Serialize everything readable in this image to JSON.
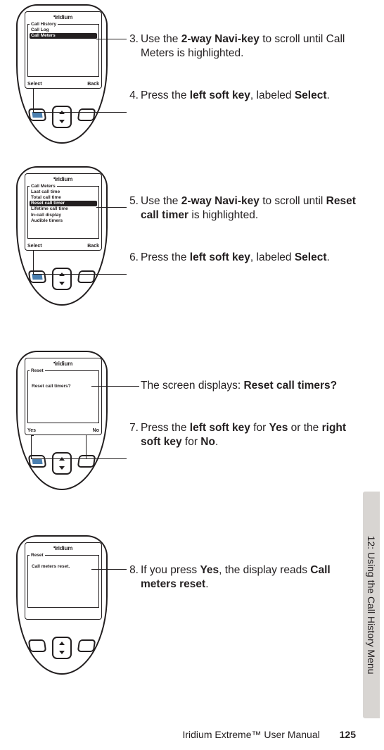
{
  "brand": "iridium",
  "screens": {
    "s1": {
      "title": "Call History",
      "items": [
        "Call Log",
        "Call Meters"
      ],
      "selected": 1,
      "left": "Select",
      "right": "Back"
    },
    "s2": {
      "title": "Call Meters",
      "items": [
        "Last call time",
        "Total call time",
        "Reset call timer",
        "Lifetime call time",
        "In-call display",
        "Audible timers"
      ],
      "selected": 2,
      "left": "Select",
      "right": "Back"
    },
    "s3": {
      "title": "Reset",
      "message": "Reset call timers?",
      "left": "Yes",
      "right": "No"
    },
    "s4": {
      "title": "Reset",
      "message": "Call meters reset.",
      "left": "",
      "right": ""
    }
  },
  "steps": {
    "3": {
      "n": "3.",
      "pre": "Use the ",
      "b1": "2-way Navi-key",
      "post": " to scroll until Call Meters is highlighted."
    },
    "4": {
      "n": "4.",
      "pre": "Press the ",
      "b1": "left soft key",
      "mid": ", labeled ",
      "b2": "Select",
      "post": "."
    },
    "5": {
      "n": "5.",
      "pre": "Use the ",
      "b1": "2-way Navi-key",
      "mid": " to scroll until ",
      "b2": "Reset call timer",
      "post": " is highlighted."
    },
    "6": {
      "n": "6.",
      "pre": "Press the ",
      "b1": "left soft key",
      "mid": ", labeled ",
      "b2": "Select",
      "post": "."
    },
    "7a": {
      "plain": "The screen displays: ",
      "b1": "Reset call timers?"
    },
    "7": {
      "n": "7.",
      "pre": "Press the ",
      "b1": "left soft key",
      "mid": " for ",
      "b2": "Yes",
      "mid2": " or the ",
      "b3": "right soft key",
      "mid3": " for ",
      "b4": "No",
      "post": "."
    },
    "8": {
      "n": "8.",
      "pre": "If you press ",
      "b1": "Yes",
      "mid": ", the display reads ",
      "b2": "Call meters reset",
      "post": "."
    }
  },
  "tab": "12: Using the Call History Menu",
  "footer_title": "Iridium Extreme™ User Manual",
  "footer_page": "125"
}
